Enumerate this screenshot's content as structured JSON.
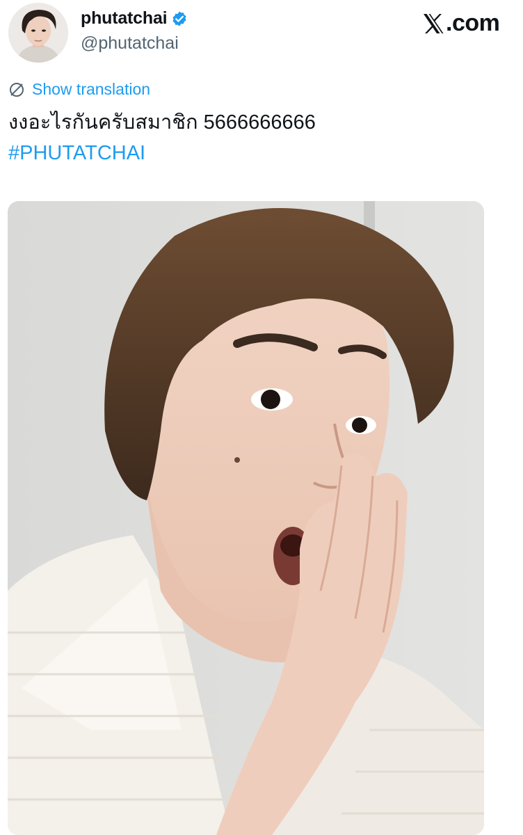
{
  "author": {
    "display_name": "phutatchai",
    "handle": "@phutatchai",
    "verified": true,
    "avatar_icon": "profile-photo"
  },
  "brand": {
    "logo_icon": "x-logo-icon",
    "label": ".com"
  },
  "tweet": {
    "translate_label": "Show translation",
    "text": "งงอะไรกันครับสมาชิก 5666666666",
    "hashtag": "#PHUTATCHAI"
  },
  "media": {
    "type": "photo"
  },
  "colors": {
    "accent": "#1d9bf0",
    "text": "#0f1419",
    "secondary": "#536471",
    "verified": "#1d9bf0"
  }
}
